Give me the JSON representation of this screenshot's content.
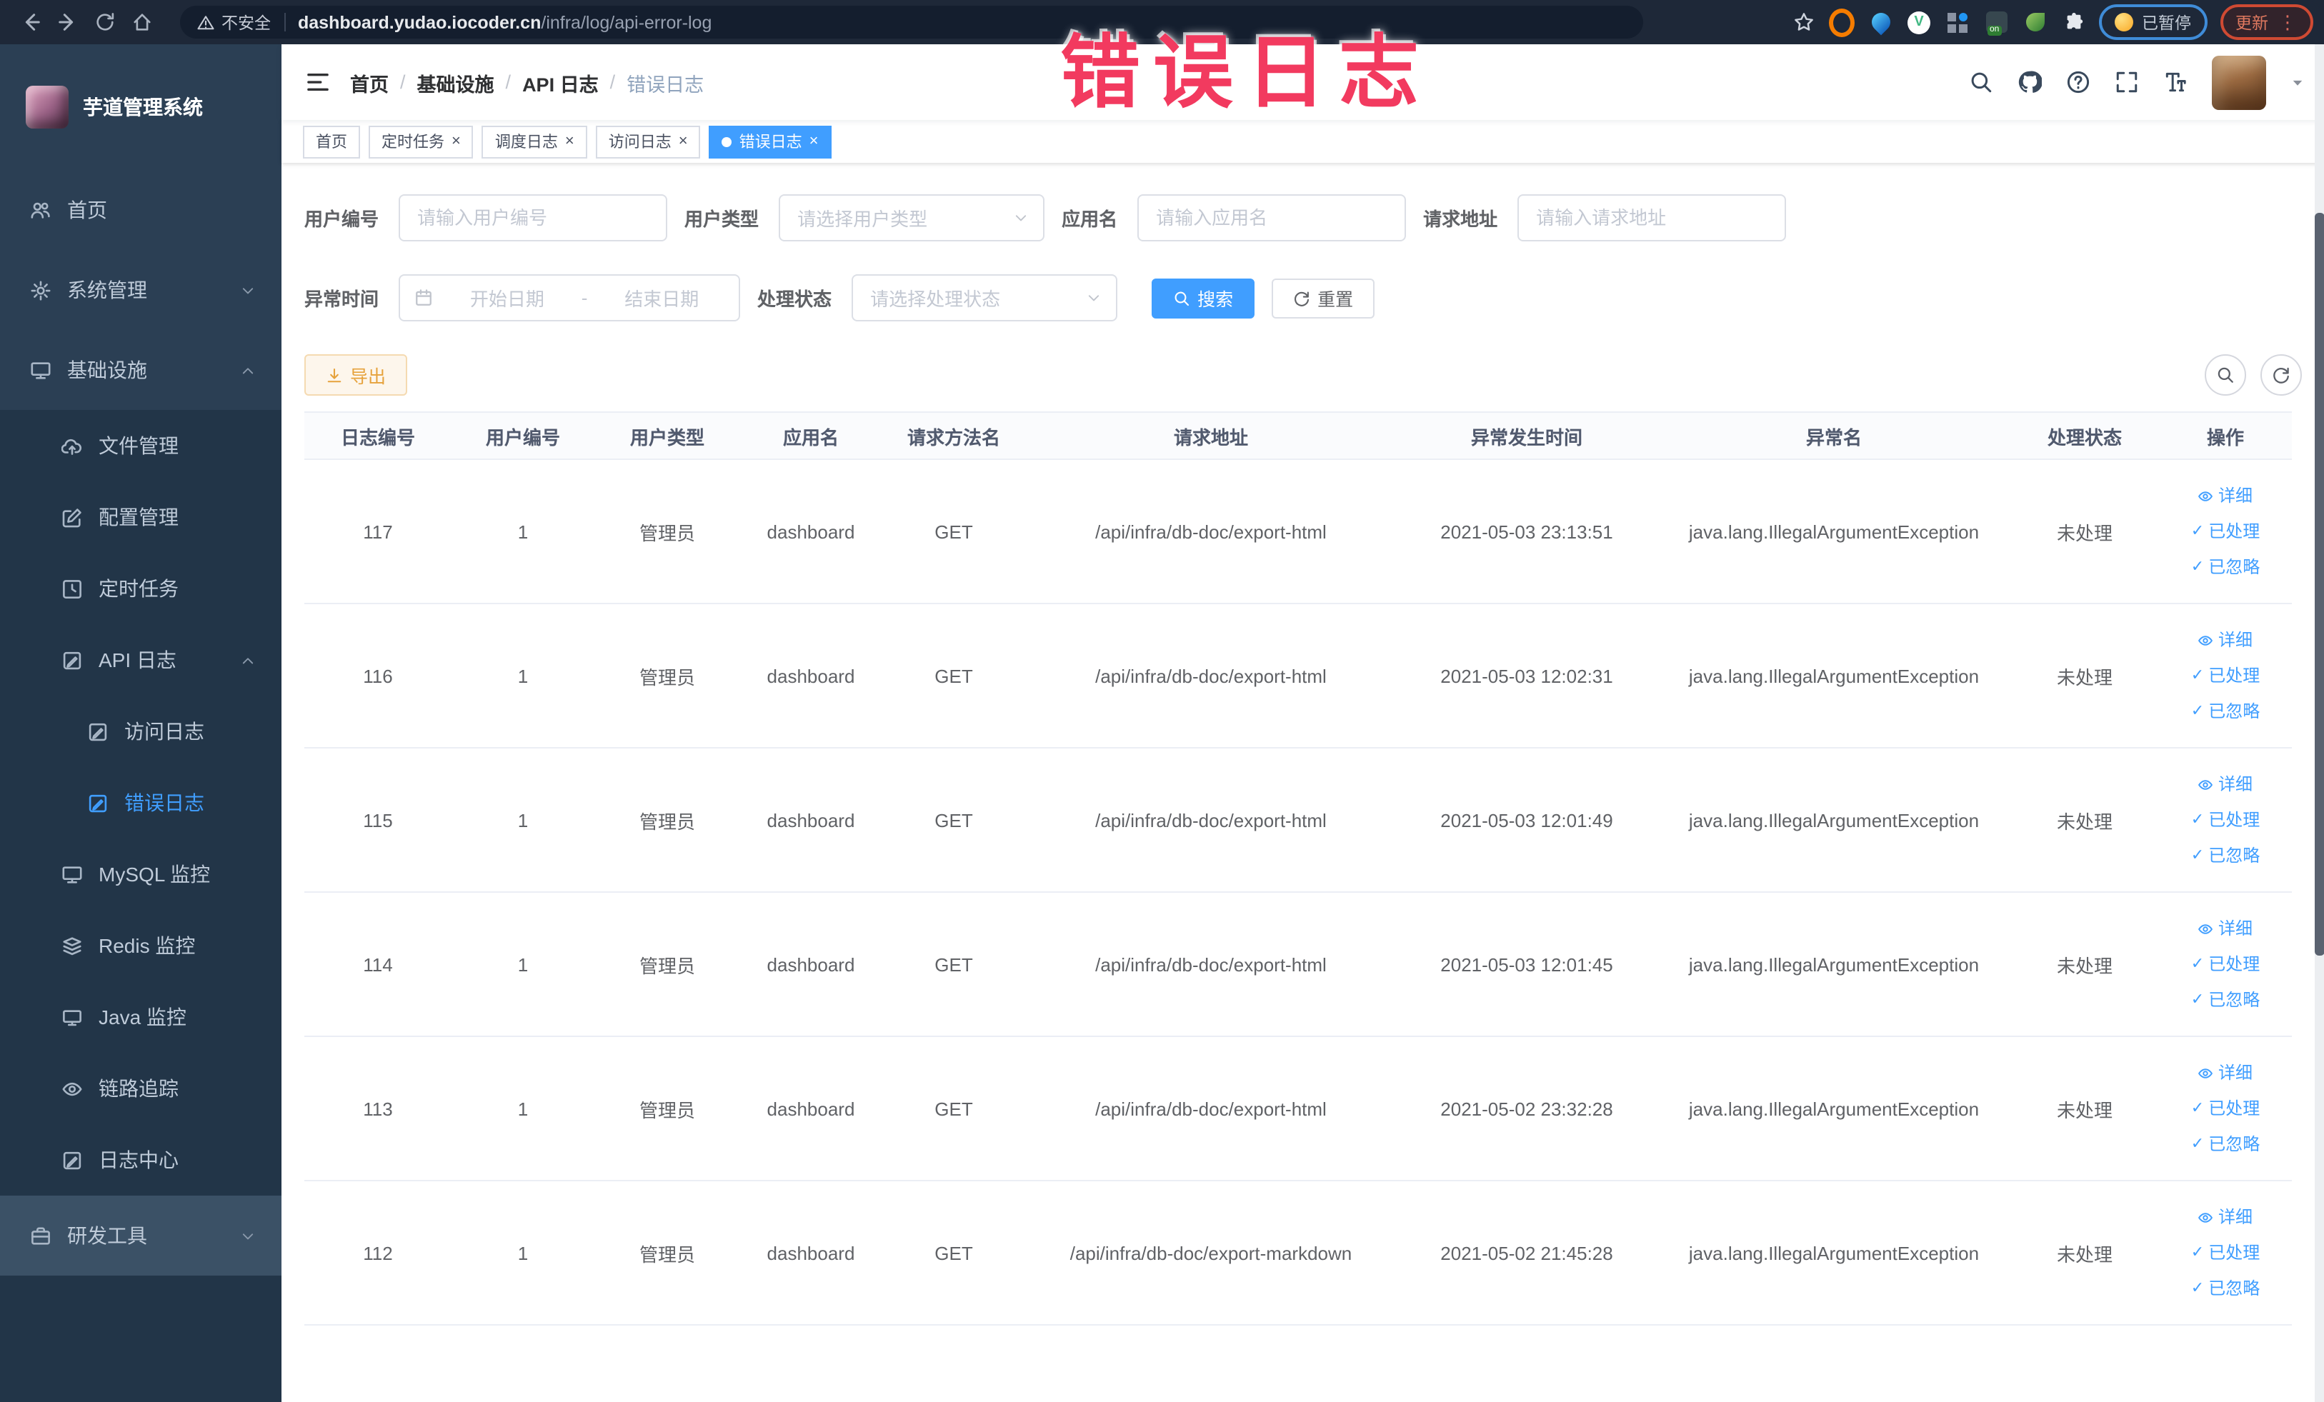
{
  "browser": {
    "security_label": "不安全",
    "url_host": "dashboard.yudao.iocoder.cn",
    "url_path": "/infra/log/api-error-log",
    "extension_icons": [
      "bookmark-star-icon",
      "ext-adblock-icon",
      "ext-shield-icon",
      "ext-vue-devtools-icon",
      "ext-grid-icon",
      "ext-switch-on-icon",
      "ext-leaf-icon",
      "extensions-puzzle-icon"
    ],
    "profile_status": "已暂停",
    "update_label": "更新"
  },
  "annotation": {
    "text": "错误日志",
    "color": "#f23a5f"
  },
  "sidebar": {
    "app_title": "芋道管理系统",
    "items": [
      {
        "key": "home",
        "label": "首页",
        "icon": "people-icon",
        "level": 0
      },
      {
        "key": "system",
        "label": "系统管理",
        "icon": "gear-icon",
        "level": 0,
        "arrow": "down"
      },
      {
        "key": "infra",
        "label": "基础设施",
        "icon": "monitor-icon",
        "level": 0,
        "arrow": "up"
      },
      {
        "key": "file",
        "label": "文件管理",
        "icon": "cloud-upload-icon",
        "level": 1
      },
      {
        "key": "config",
        "label": "配置管理",
        "icon": "edit-icon",
        "level": 1
      },
      {
        "key": "job",
        "label": "定时任务",
        "icon": "schedule-icon",
        "level": 1
      },
      {
        "key": "api-log",
        "label": "API 日志",
        "icon": "log-icon",
        "level": 1,
        "arrow": "up"
      },
      {
        "key": "access-log",
        "label": "访问日志",
        "icon": "log-icon",
        "level": 2
      },
      {
        "key": "error-log",
        "label": "错误日志",
        "icon": "log-icon",
        "level": 2,
        "active": true
      },
      {
        "key": "mysql",
        "label": "MySQL 监控",
        "icon": "monitor-icon",
        "level": 1
      },
      {
        "key": "redis",
        "label": "Redis 监控",
        "icon": "layers-icon",
        "level": 1
      },
      {
        "key": "java",
        "label": "Java 监控",
        "icon": "desktop-icon",
        "level": 1
      },
      {
        "key": "trace",
        "label": "链路追踪",
        "icon": "eye-icon",
        "level": 1
      },
      {
        "key": "log-center",
        "label": "日志中心",
        "icon": "log-icon",
        "level": 1
      },
      {
        "key": "dev-tools",
        "label": "研发工具",
        "icon": "briefcase-icon",
        "level": 0,
        "arrow": "down",
        "section": true
      }
    ]
  },
  "header": {
    "breadcrumb": [
      "首页",
      "基础设施",
      "API 日志",
      "错误日志"
    ]
  },
  "tabs": [
    {
      "key": "home",
      "label": "首页",
      "closable": false,
      "active": false
    },
    {
      "key": "job",
      "label": "定时任务",
      "closable": true,
      "active": false
    },
    {
      "key": "job-log",
      "label": "调度日志",
      "closable": true,
      "active": false
    },
    {
      "key": "access-log",
      "label": "访问日志",
      "closable": true,
      "active": false
    },
    {
      "key": "error-log",
      "label": "错误日志",
      "closable": true,
      "active": true
    }
  ],
  "filters": {
    "user_id_label": "用户编号",
    "user_id_placeholder": "请输入用户编号",
    "user_type_label": "用户类型",
    "user_type_placeholder": "请选择用户类型",
    "app_name_label": "应用名",
    "app_name_placeholder": "请输入应用名",
    "request_url_label": "请求地址",
    "request_url_placeholder": "请输入请求地址",
    "exception_time_label": "异常时间",
    "date_start_placeholder": "开始日期",
    "date_separator": "-",
    "date_end_placeholder": "结束日期",
    "process_status_label": "处理状态",
    "process_status_placeholder": "请选择处理状态",
    "search_label": "搜索",
    "reset_label": "重置"
  },
  "toolbar": {
    "export_label": "导出"
  },
  "table": {
    "columns": [
      "日志编号",
      "用户编号",
      "用户类型",
      "应用名",
      "请求方法名",
      "请求地址",
      "异常发生时间",
      "异常名",
      "处理状态",
      "操作"
    ],
    "action_labels": [
      "详细",
      "已处理",
      "已忽略"
    ],
    "rows": [
      {
        "id": "117",
        "user_id": "1",
        "user_type": "管理员",
        "app": "dashboard",
        "method": "GET",
        "url": "/api/infra/db-doc/export-html",
        "time": "2021-05-03 23:13:51",
        "exception": "java.lang.IllegalArgumentException",
        "status": "未处理"
      },
      {
        "id": "116",
        "user_id": "1",
        "user_type": "管理员",
        "app": "dashboard",
        "method": "GET",
        "url": "/api/infra/db-doc/export-html",
        "time": "2021-05-03 12:02:31",
        "exception": "java.lang.IllegalArgumentException",
        "status": "未处理"
      },
      {
        "id": "115",
        "user_id": "1",
        "user_type": "管理员",
        "app": "dashboard",
        "method": "GET",
        "url": "/api/infra/db-doc/export-html",
        "time": "2021-05-03 12:01:49",
        "exception": "java.lang.IllegalArgumentException",
        "status": "未处理"
      },
      {
        "id": "114",
        "user_id": "1",
        "user_type": "管理员",
        "app": "dashboard",
        "method": "GET",
        "url": "/api/infra/db-doc/export-html",
        "time": "2021-05-03 12:01:45",
        "exception": "java.lang.IllegalArgumentException",
        "status": "未处理"
      },
      {
        "id": "113",
        "user_id": "1",
        "user_type": "管理员",
        "app": "dashboard",
        "method": "GET",
        "url": "/api/infra/db-doc/export-html",
        "time": "2021-05-02 23:32:28",
        "exception": "java.lang.IllegalArgumentException",
        "status": "未处理"
      },
      {
        "id": "112",
        "user_id": "1",
        "user_type": "管理员",
        "app": "dashboard",
        "method": "GET",
        "url": "/api/infra/db-doc/export-markdown",
        "time": "2021-05-02 21:45:28",
        "exception": "java.lang.IllegalArgumentException",
        "status": "未处理"
      }
    ]
  }
}
